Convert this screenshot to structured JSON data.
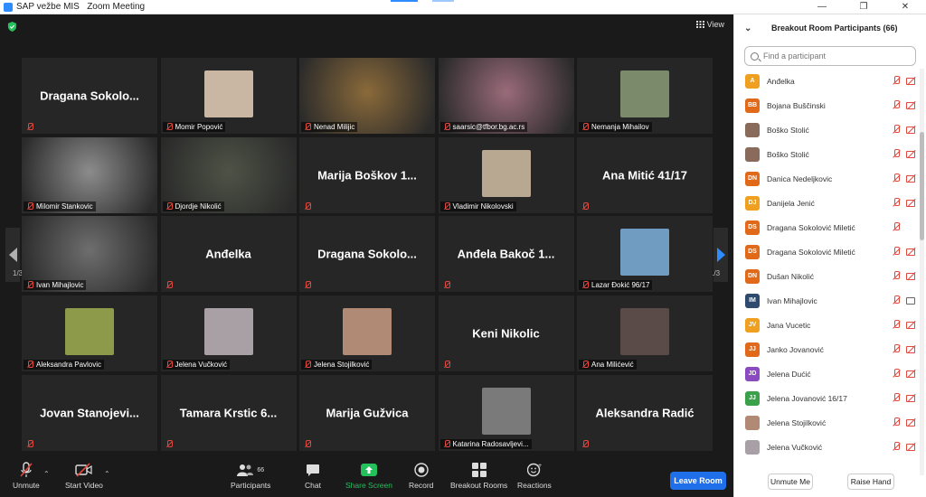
{
  "titlebar": {
    "app": "SAP vežbe MIS",
    "meeting": "Zoom Meeting"
  },
  "view_label": "View",
  "page_left": "1/3",
  "page_right": "1/3",
  "tiles": [
    {
      "big": "Dragana Sokolo...",
      "label": "",
      "kind": "text"
    },
    {
      "big": "",
      "label": "Momir Popović",
      "kind": "avatar",
      "color": "#c9b7a3"
    },
    {
      "big": "",
      "label": "Nenad Milijic",
      "kind": "video",
      "color": "#8a6a3a"
    },
    {
      "big": "",
      "label": "saarsic@tfbor.bg.ac.rs",
      "kind": "video",
      "color": "#9a6b7a"
    },
    {
      "big": "",
      "label": "Nemanja Mihailov",
      "kind": "avatar",
      "color": "#7a8a6a"
    },
    {
      "big": "",
      "label": "Milomir Stankovic",
      "kind": "video",
      "color": "#8c8c8c"
    },
    {
      "big": "",
      "label": "Djordje Nikolić",
      "kind": "video",
      "color": "#4e5346",
      "active": true
    },
    {
      "big": "Marija Boškov 1...",
      "label": "",
      "kind": "text"
    },
    {
      "big": "",
      "label": "Vladimir Nikolovski",
      "kind": "avatar",
      "color": "#b8a892"
    },
    {
      "big": "Ana Mitić 41/17",
      "label": "",
      "kind": "text"
    },
    {
      "big": "",
      "label": "Ivan Mihajlovic",
      "kind": "video",
      "color": "#6e6e6e"
    },
    {
      "big": "Anđelka",
      "label": "",
      "kind": "text"
    },
    {
      "big": "Dragana Sokolo...",
      "label": "",
      "kind": "text"
    },
    {
      "big": "Anđela Bakoč 1...",
      "label": "",
      "kind": "text"
    },
    {
      "big": "",
      "label": "Lazar Đokić 96/17",
      "kind": "avatar",
      "color": "#6f9cc0"
    },
    {
      "big": "",
      "label": "Aleksandra Pavlovic",
      "kind": "avatar",
      "color": "#8d9a4a"
    },
    {
      "big": "",
      "label": "Jelena Vučković",
      "kind": "avatar",
      "color": "#a8a0a4"
    },
    {
      "big": "",
      "label": "Jelena Stojilković",
      "kind": "avatar",
      "color": "#b08a74"
    },
    {
      "big": "Keni Nikolic",
      "label": "",
      "kind": "text"
    },
    {
      "big": "",
      "label": "Ana Milićević",
      "kind": "avatar",
      "color": "#5a4a48"
    },
    {
      "big": "Jovan Stanojevi...",
      "label": "",
      "kind": "text"
    },
    {
      "big": "Tamara Krstic 6...",
      "label": "",
      "kind": "text"
    },
    {
      "big": "Marija Gužvica",
      "label": "",
      "kind": "text"
    },
    {
      "big": "",
      "label": "Katarina Radosavljevi...",
      "kind": "avatar",
      "color": "#7a7a7a"
    },
    {
      "big": "Aleksandra Radić",
      "label": "",
      "kind": "text"
    }
  ],
  "toolbar": {
    "unmute": "Unmute",
    "start_video": "Start Video",
    "participants": "Participants",
    "participants_count": "66",
    "chat": "Chat",
    "share": "Share Screen",
    "record": "Record",
    "breakout": "Breakout Rooms",
    "reactions": "Reactions",
    "leave": "Leave Room"
  },
  "panel": {
    "title": "Breakout Room Participants (66)",
    "search_placeholder": "Find a participant",
    "unmute_me": "Unmute Me",
    "raise_hand": "Raise Hand",
    "participants": [
      {
        "initials": "A",
        "name": "Anđelka",
        "color": "#f0a020",
        "video": false
      },
      {
        "initials": "BB",
        "name": "Bojana Buščinski",
        "color": "#e06a1a",
        "video": false
      },
      {
        "initials": "",
        "name": "Boško Stolić",
        "color": "#8a6a5a",
        "video": false
      },
      {
        "initials": "",
        "name": "Boško Stolić",
        "color": "#8a6a5a",
        "video": false
      },
      {
        "initials": "DN",
        "name": "Danica Nedeljkovic",
        "color": "#e06a1a",
        "video": false
      },
      {
        "initials": "DJ",
        "name": "Danijela Jenić",
        "color": "#f0a020",
        "video": false
      },
      {
        "initials": "DS",
        "name": "Dragana Sokolović Miletić",
        "color": "#e06a1a",
        "video": null
      },
      {
        "initials": "DS",
        "name": "Dragana Sokolović Miletić",
        "color": "#e06a1a",
        "video": false
      },
      {
        "initials": "DN",
        "name": "Dušan Nikolić",
        "color": "#e06a1a",
        "video": false
      },
      {
        "initials": "IM",
        "name": "Ivan Mihajlovic",
        "color": "#2e4a6e",
        "video": true
      },
      {
        "initials": "JV",
        "name": "Jana Vucetic",
        "color": "#f0a020",
        "video": false
      },
      {
        "initials": "JJ",
        "name": "Janko Jovanović",
        "color": "#e06a1a",
        "video": false
      },
      {
        "initials": "JD",
        "name": "Jelena Dućić",
        "color": "#8a4ac0",
        "video": false
      },
      {
        "initials": "JJ",
        "name": "Jelena Jovanović 16/17",
        "color": "#3aa04a",
        "video": false
      },
      {
        "initials": "",
        "name": "Jelena Stojilković",
        "color": "#b08a74",
        "video": false
      },
      {
        "initials": "",
        "name": "Jelena Vučković",
        "color": "#a8a0a4",
        "video": false
      }
    ]
  },
  "colors": {
    "accent": "#2d8cff",
    "leave": "#1f6feb",
    "muted_red": "#e0483e",
    "share_green": "#23c05c",
    "active_border": "#b6d56a"
  }
}
